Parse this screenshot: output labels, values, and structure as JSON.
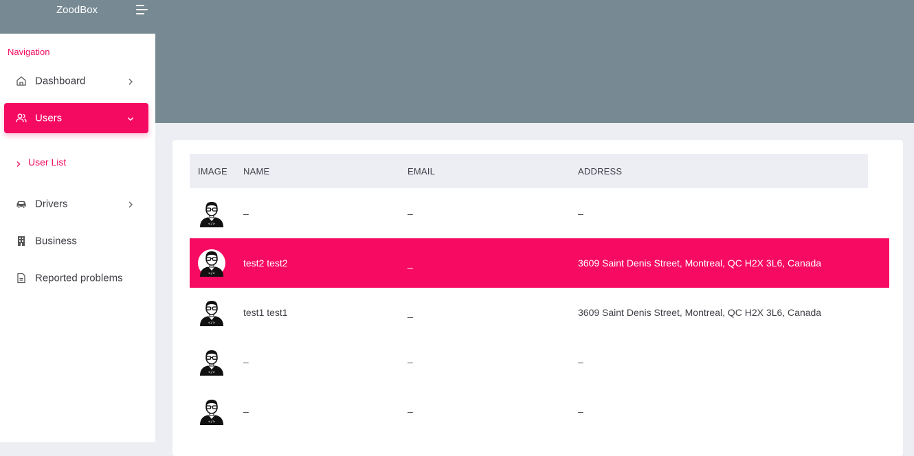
{
  "app": {
    "brand": "ZoodBox"
  },
  "sidebar": {
    "title": "Navigation",
    "items": [
      {
        "label": "Dashboard",
        "icon": "home-icon",
        "has_chevron": true
      },
      {
        "label": "Users",
        "icon": "users-icon",
        "active": true,
        "expanded": true
      },
      {
        "label": "Drivers",
        "icon": "car-icon",
        "has_chevron": true
      },
      {
        "label": "Business",
        "icon": "building-icon"
      },
      {
        "label": "Reported problems",
        "icon": "file-icon"
      }
    ],
    "subitems": [
      {
        "label": "User List"
      }
    ]
  },
  "table": {
    "headers": {
      "image": "IMAGE",
      "name": "NAME",
      "email": "EMAIL",
      "address": "ADDRESS"
    },
    "rows": [
      {
        "name": "–",
        "email": "–",
        "address": "–",
        "selected": false
      },
      {
        "name": "test2 test2",
        "email": "_",
        "address": "3609 Saint Denis Street, Montreal, QC H2X 3L6, Canada",
        "selected": true
      },
      {
        "name": "test1 test1",
        "email": "_",
        "address": "3609 Saint Denis Street, Montreal, QC H2X 3L6, Canada",
        "selected": false
      },
      {
        "name": "–",
        "email": "–",
        "address": "–",
        "selected": false
      },
      {
        "name": "–",
        "email": "–",
        "address": "–",
        "selected": false
      }
    ]
  },
  "colors": {
    "accent": "#f50a62",
    "header_bg": "#778a93",
    "page_bg": "#eceef3"
  }
}
